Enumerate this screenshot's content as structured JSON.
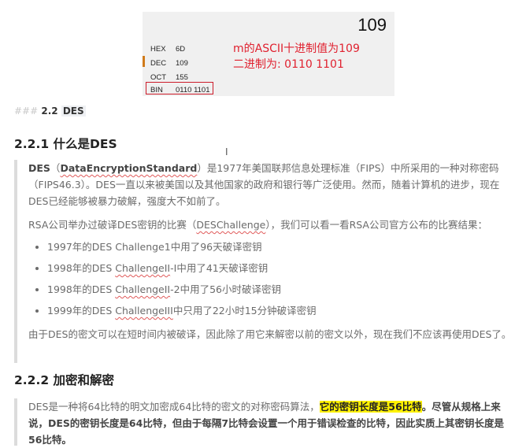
{
  "calculator": {
    "display": "109",
    "rows": [
      {
        "label": "HEX",
        "value": "6D"
      },
      {
        "label": "DEC",
        "value": "109"
      },
      {
        "label": "OCT",
        "value": "155"
      },
      {
        "label": "BIN",
        "value": "0110 1101"
      }
    ],
    "note_line1": "m的ASCII十进制值为109",
    "note_line2": "二进制为: 0110 1101"
  },
  "heading3": {
    "hashes": "###",
    "num": "2.2",
    "code": "DES"
  },
  "cursor": "I",
  "section1": {
    "title": "2.2.1 什么是DES",
    "intro_bold": "DES",
    "intro_paren_open": "（",
    "intro_term": "DataEncryptionStandard",
    "intro_paren_close": "）",
    "intro_rest": "是1977年美国联邦信息处理标准（FIPS）中所采用的一种对称密码（FIPS46.3）。DES一直以来被美国以及其他国家的政府和银行等广泛使用。然而，随着计算机的进步，现在DES已经能够被暴力破解，强度大不如前了。",
    "rsa_prefix": "RSA公司举办过破译DES密钥的比赛（",
    "rsa_term": "DESChallenge",
    "rsa_suffix": "），我们可以看一看RSA公司官方公布的比赛结果：",
    "items": [
      {
        "pre": "1997年的DES Challenge1中用了96天破译密钥",
        "term": "",
        "post": ""
      },
      {
        "pre": "1998年的DES ",
        "term": "ChallengeII",
        "post": "-I中用了41天破译密钥"
      },
      {
        "pre": "1998年的DES ",
        "term": "ChallengeII",
        "post": "-2中用了56小时破译密钥"
      },
      {
        "pre": "1999年的DES ",
        "term": "ChallengeIII",
        "post": "中只用了22小时15分钟破译密钥"
      }
    ],
    "conclusion": "由于DES的密文可以在短时间内被破译，因此除了用它来解密以前的密文以外，现在我们不应该再使用DES了。"
  },
  "section2": {
    "title": "2.2.2 加密和解密",
    "p_pre": "DES是一种将64比特的明文加密成64比特的密文的对称密码算法，",
    "p_highlight": "它的密钥长度是56比特",
    "p_bold": "。尽管从规格上来说，DES的密钥长度是64比特，但由于每隔7比特会设置一个用于错误检查的比特，因此实质上其密钥长度是56比特。"
  }
}
